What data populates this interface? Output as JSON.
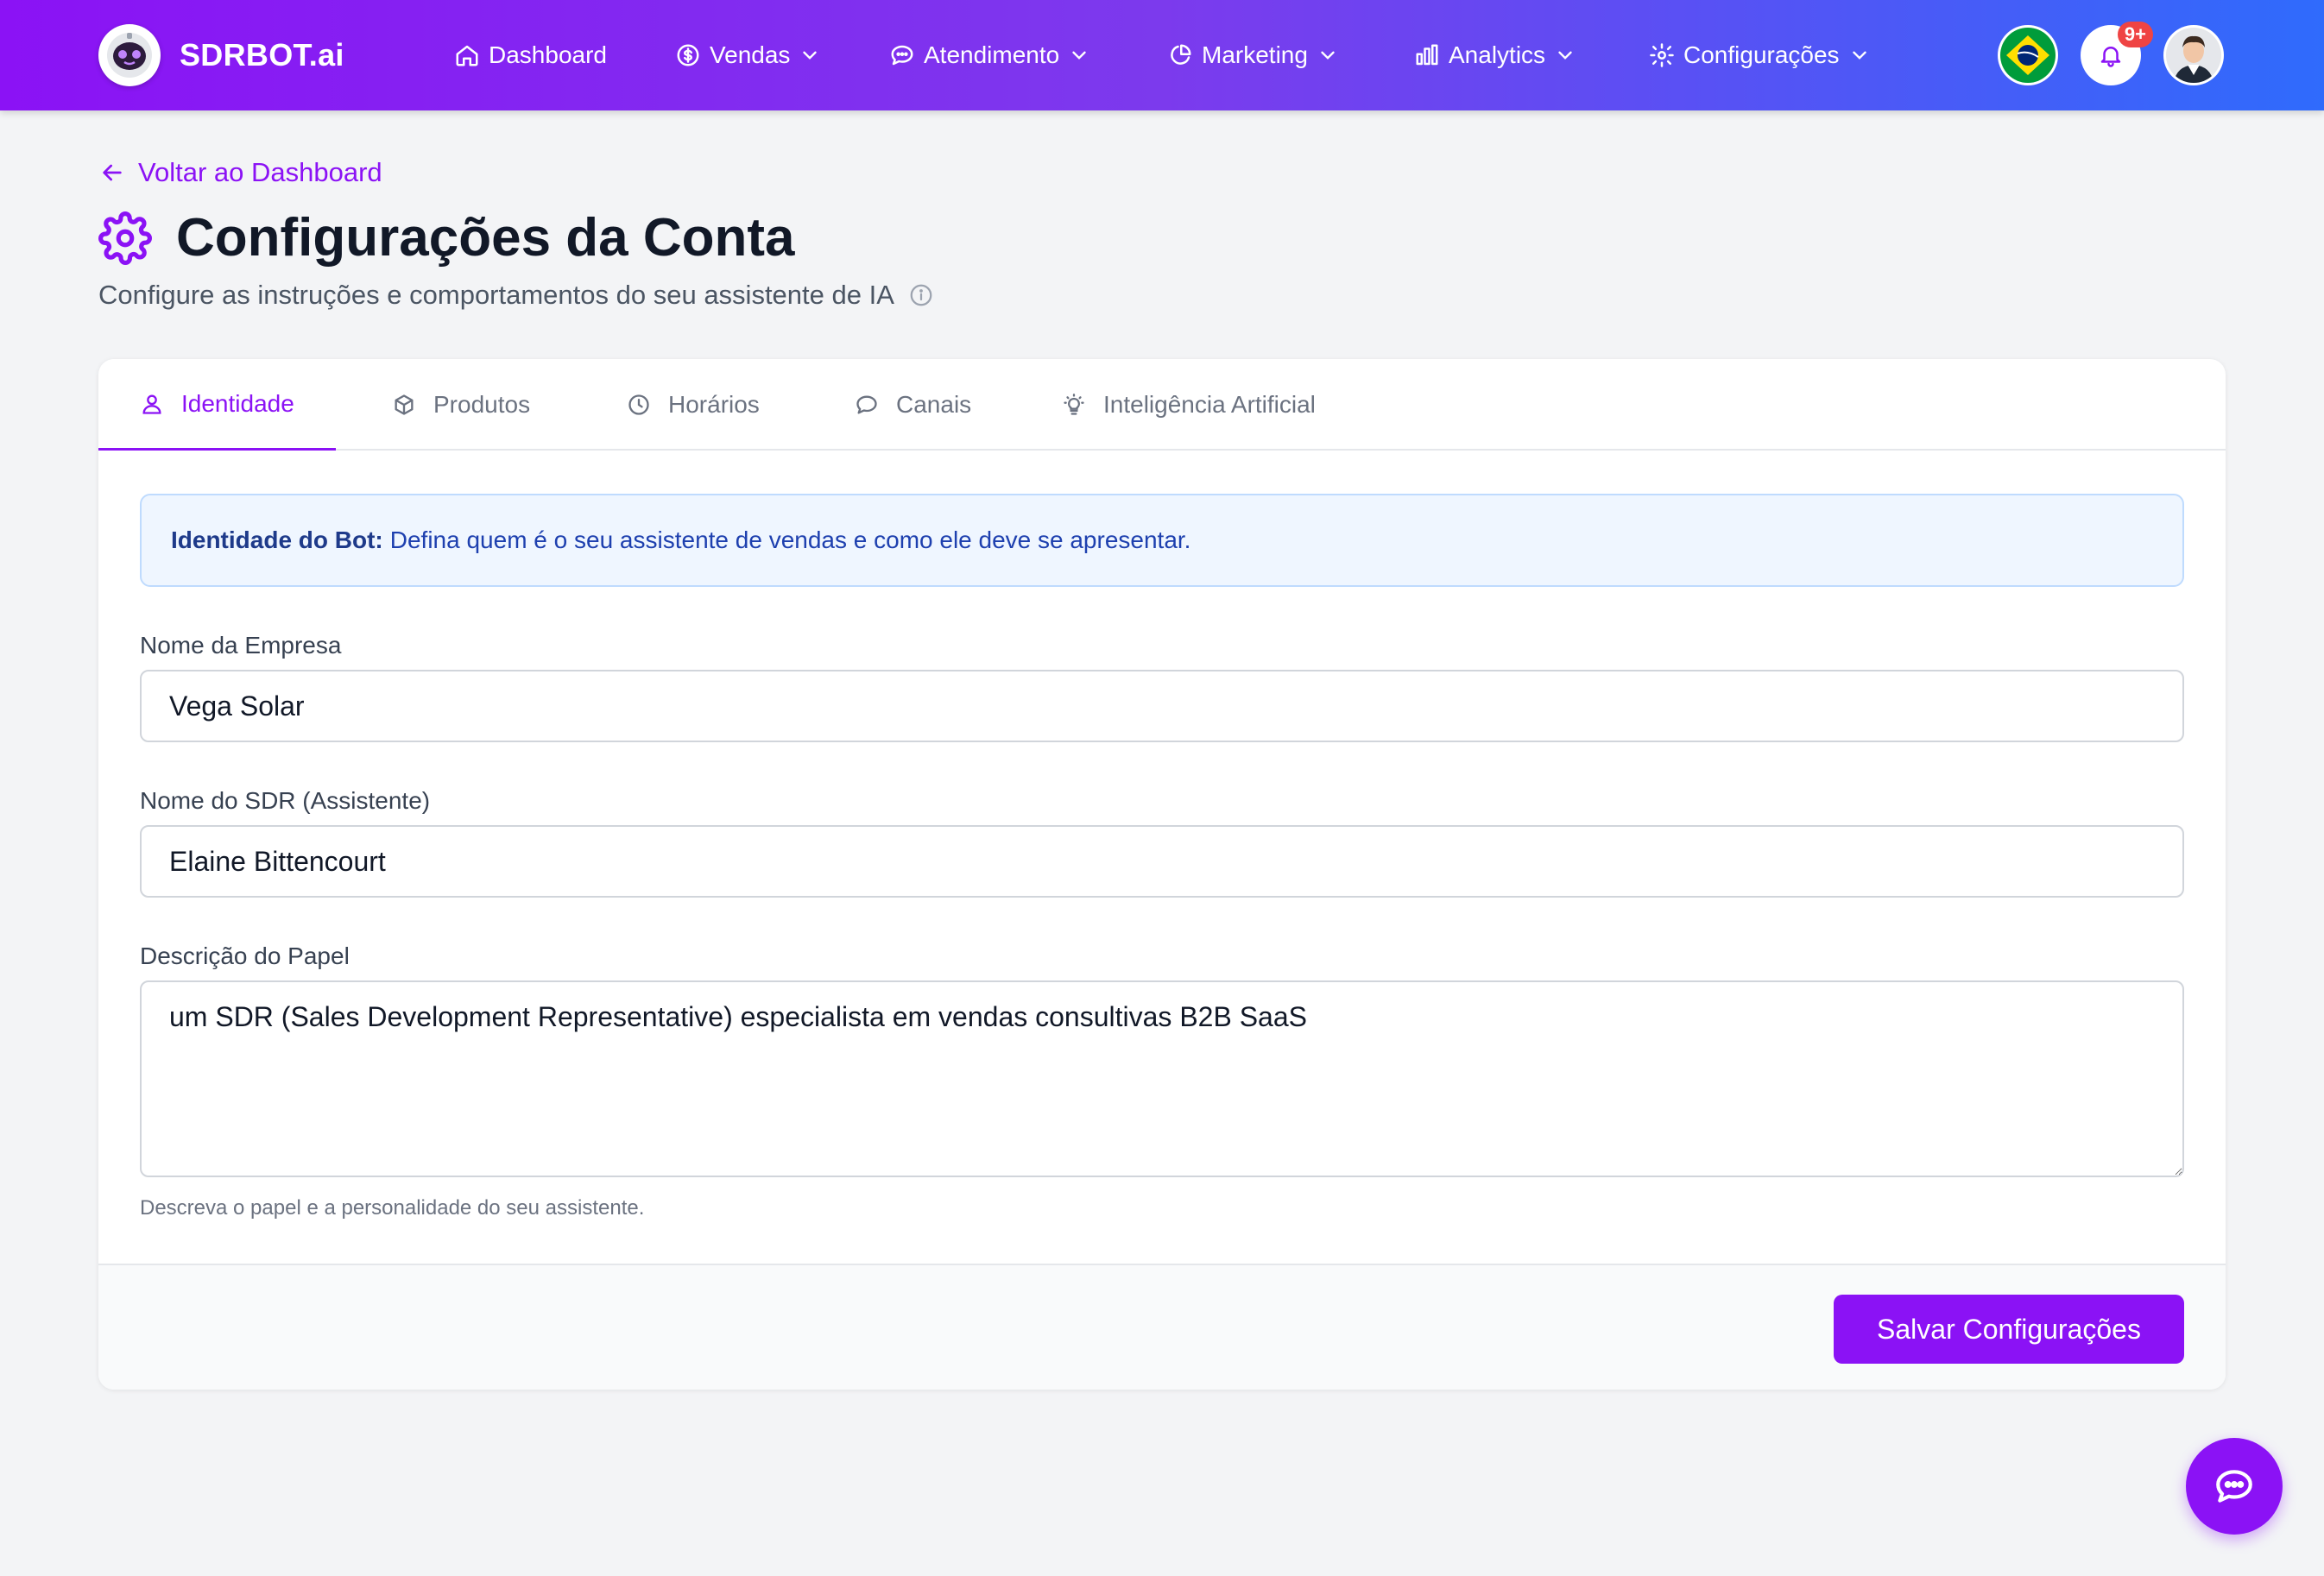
{
  "navbar": {
    "brand": "SDRBOT.ai",
    "items": [
      {
        "label": "Dashboard",
        "icon": "home-icon"
      },
      {
        "label": "Vendas",
        "icon": "dollar-icon"
      },
      {
        "label": "Atendimento",
        "icon": "chat-icon"
      },
      {
        "label": "Marketing",
        "icon": "pie-chart-icon"
      },
      {
        "label": "Analytics",
        "icon": "bar-chart-icon"
      },
      {
        "label": "Configurações",
        "icon": "gear-icon"
      }
    ],
    "notifications_badge": "9+",
    "language_flag": "brazil-flag-icon"
  },
  "header": {
    "back_link": "Voltar ao Dashboard",
    "title": "Configurações da Conta",
    "subtitle": "Configure as instruções e comportamentos do seu assistente de IA"
  },
  "tabs": [
    {
      "label": "Identidade",
      "active": true
    },
    {
      "label": "Produtos",
      "active": false
    },
    {
      "label": "Horários",
      "active": false
    },
    {
      "label": "Canais",
      "active": false
    },
    {
      "label": "Inteligência Artificial",
      "active": false
    }
  ],
  "identity": {
    "info_title": "Identidade do Bot:",
    "info_text": "Defina quem é o seu assistente de vendas e como ele deve se apresentar.",
    "company_label": "Nome da Empresa",
    "company_value": "Vega Solar",
    "sdr_label": "Nome do SDR (Assistente)",
    "sdr_value": "Elaine Bittencourt",
    "role_label": "Descrição do Papel",
    "role_value": "um SDR (Sales Development Representative) especialista em vendas consultivas B2B SaaS",
    "role_help": "Descreva o papel e a personalidade do seu assistente."
  },
  "footer": {
    "save_label": "Salvar Configurações"
  },
  "colors": {
    "accent": "#8b12f5",
    "gradient_end": "#2f6bfc",
    "info_bg": "#eff6ff",
    "info_text": "#1e40af"
  }
}
